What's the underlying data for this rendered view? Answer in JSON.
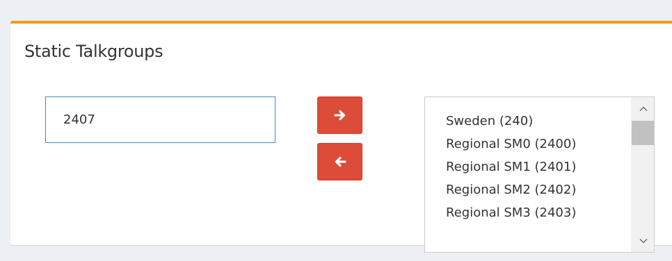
{
  "panel": {
    "title": "Static Talkgroups",
    "accent_color": "#f39c12"
  },
  "talkgroup_input": {
    "value": "2407"
  },
  "buttons": {
    "add_icon": "arrow-right-icon",
    "remove_icon": "arrow-left-icon",
    "color": "#dd4b39"
  },
  "talkgroup_list": {
    "items": [
      "Sweden (240)",
      "Regional SM0 (2400)",
      "Regional SM1 (2401)",
      "Regional SM2 (2402)",
      "Regional SM3 (2403)"
    ],
    "scroll_up_icon": "chevron-up-icon",
    "scroll_down_icon": "chevron-down-icon"
  }
}
